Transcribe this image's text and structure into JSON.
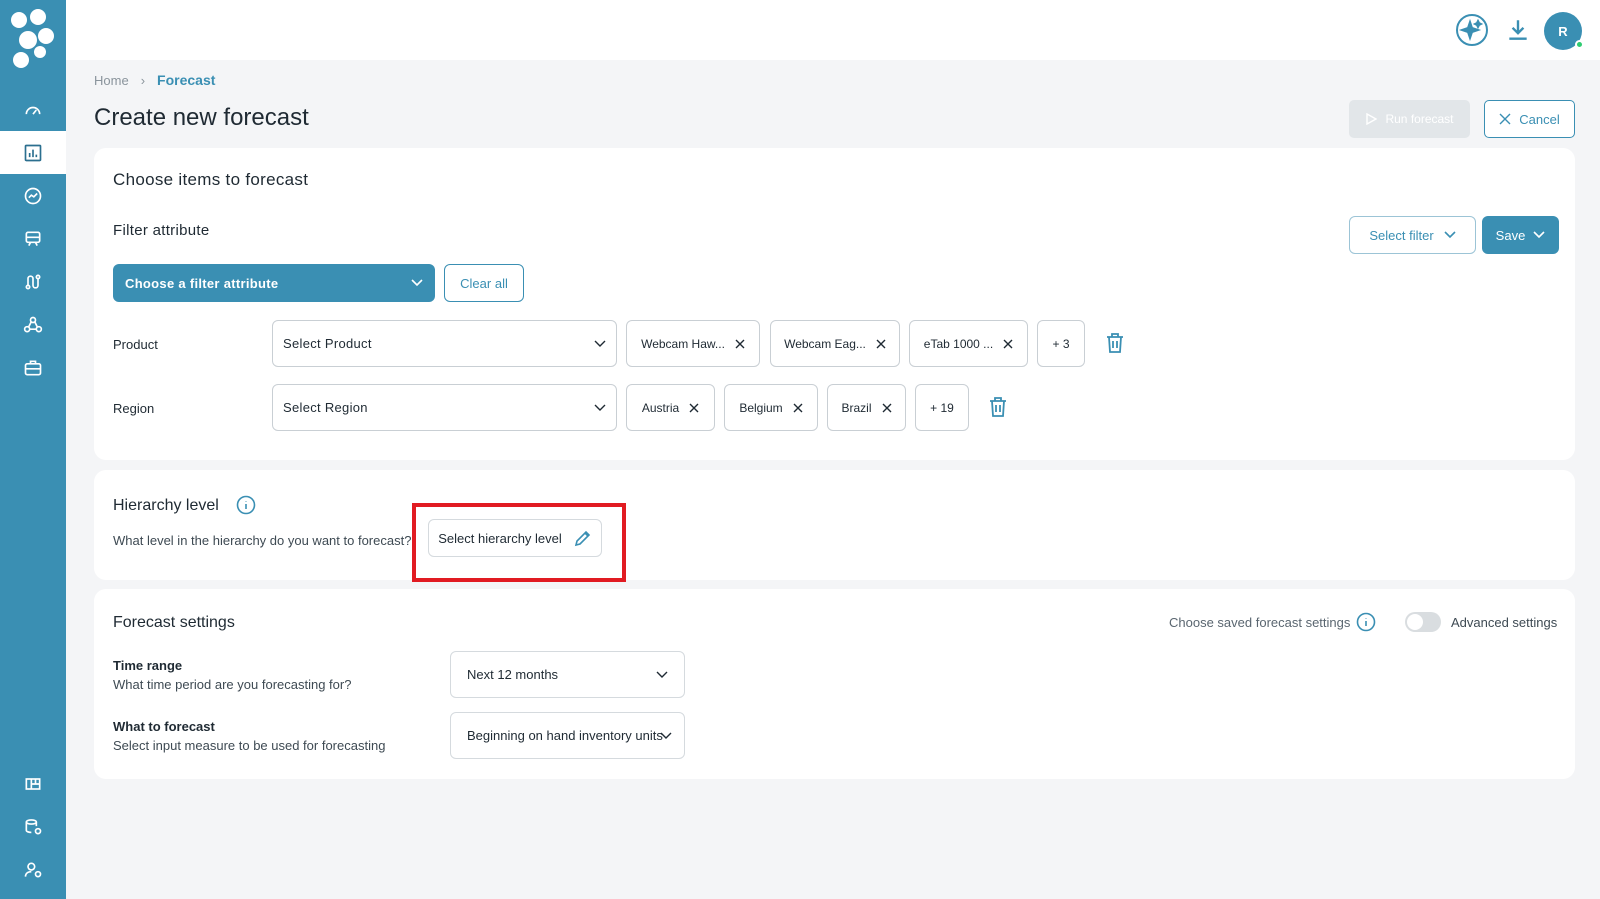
{
  "breadcrumb": {
    "home": "Home",
    "current": "Forecast"
  },
  "page": {
    "title": "Create new forecast",
    "run_label": "Run forecast",
    "cancel_label": "Cancel"
  },
  "header": {
    "avatar_initial": "R"
  },
  "items_section": {
    "title": "Choose items to forecast",
    "filter_attribute_label": "Filter attribute",
    "choose_filter_label": "Choose a filter attribute",
    "clear_all_label": "Clear all",
    "select_filter_label": "Select filter",
    "save_label": "Save",
    "filters": [
      {
        "label": "Product",
        "placeholder": "Select Product",
        "chips": [
          "Webcam Haw...",
          "Webcam Eag...",
          "eTab 1000 ..."
        ],
        "more": "+ 3"
      },
      {
        "label": "Region",
        "placeholder": "Select Region",
        "chips": [
          "Austria",
          "Belgium",
          "Brazil"
        ],
        "more": "+ 19"
      }
    ]
  },
  "hierarchy": {
    "title": "Hierarchy level",
    "question": "What level in the hierarchy do you want to forecast?",
    "button_label": "Select hierarchy level"
  },
  "settings": {
    "title": "Forecast settings",
    "saved_settings_label": "Choose saved forecast settings",
    "advanced_label": "Advanced settings",
    "advanced_enabled": false,
    "time_range": {
      "title": "Time range",
      "desc": "What time period are you forecasting for?",
      "value": "Next 12 months"
    },
    "what_to_forecast": {
      "title": "What to forecast",
      "desc": "Select input measure to be used for forecasting",
      "value": "Beginning on hand inventory units"
    }
  },
  "colors": {
    "brand": "#3a8fb3",
    "highlight": "#e11b22",
    "background": "#f4f5f7"
  },
  "icons": {
    "sidebar_top": [
      "dashboard-icon",
      "forecast-chart-icon",
      "analytics-icon",
      "transport-icon",
      "route-icon",
      "network-icon",
      "briefcase-icon"
    ],
    "sidebar_bottom": [
      "widgets-icon",
      "database-settings-icon",
      "user-settings-icon"
    ],
    "header": [
      "ai-sparkle-icon",
      "download-icon"
    ]
  }
}
